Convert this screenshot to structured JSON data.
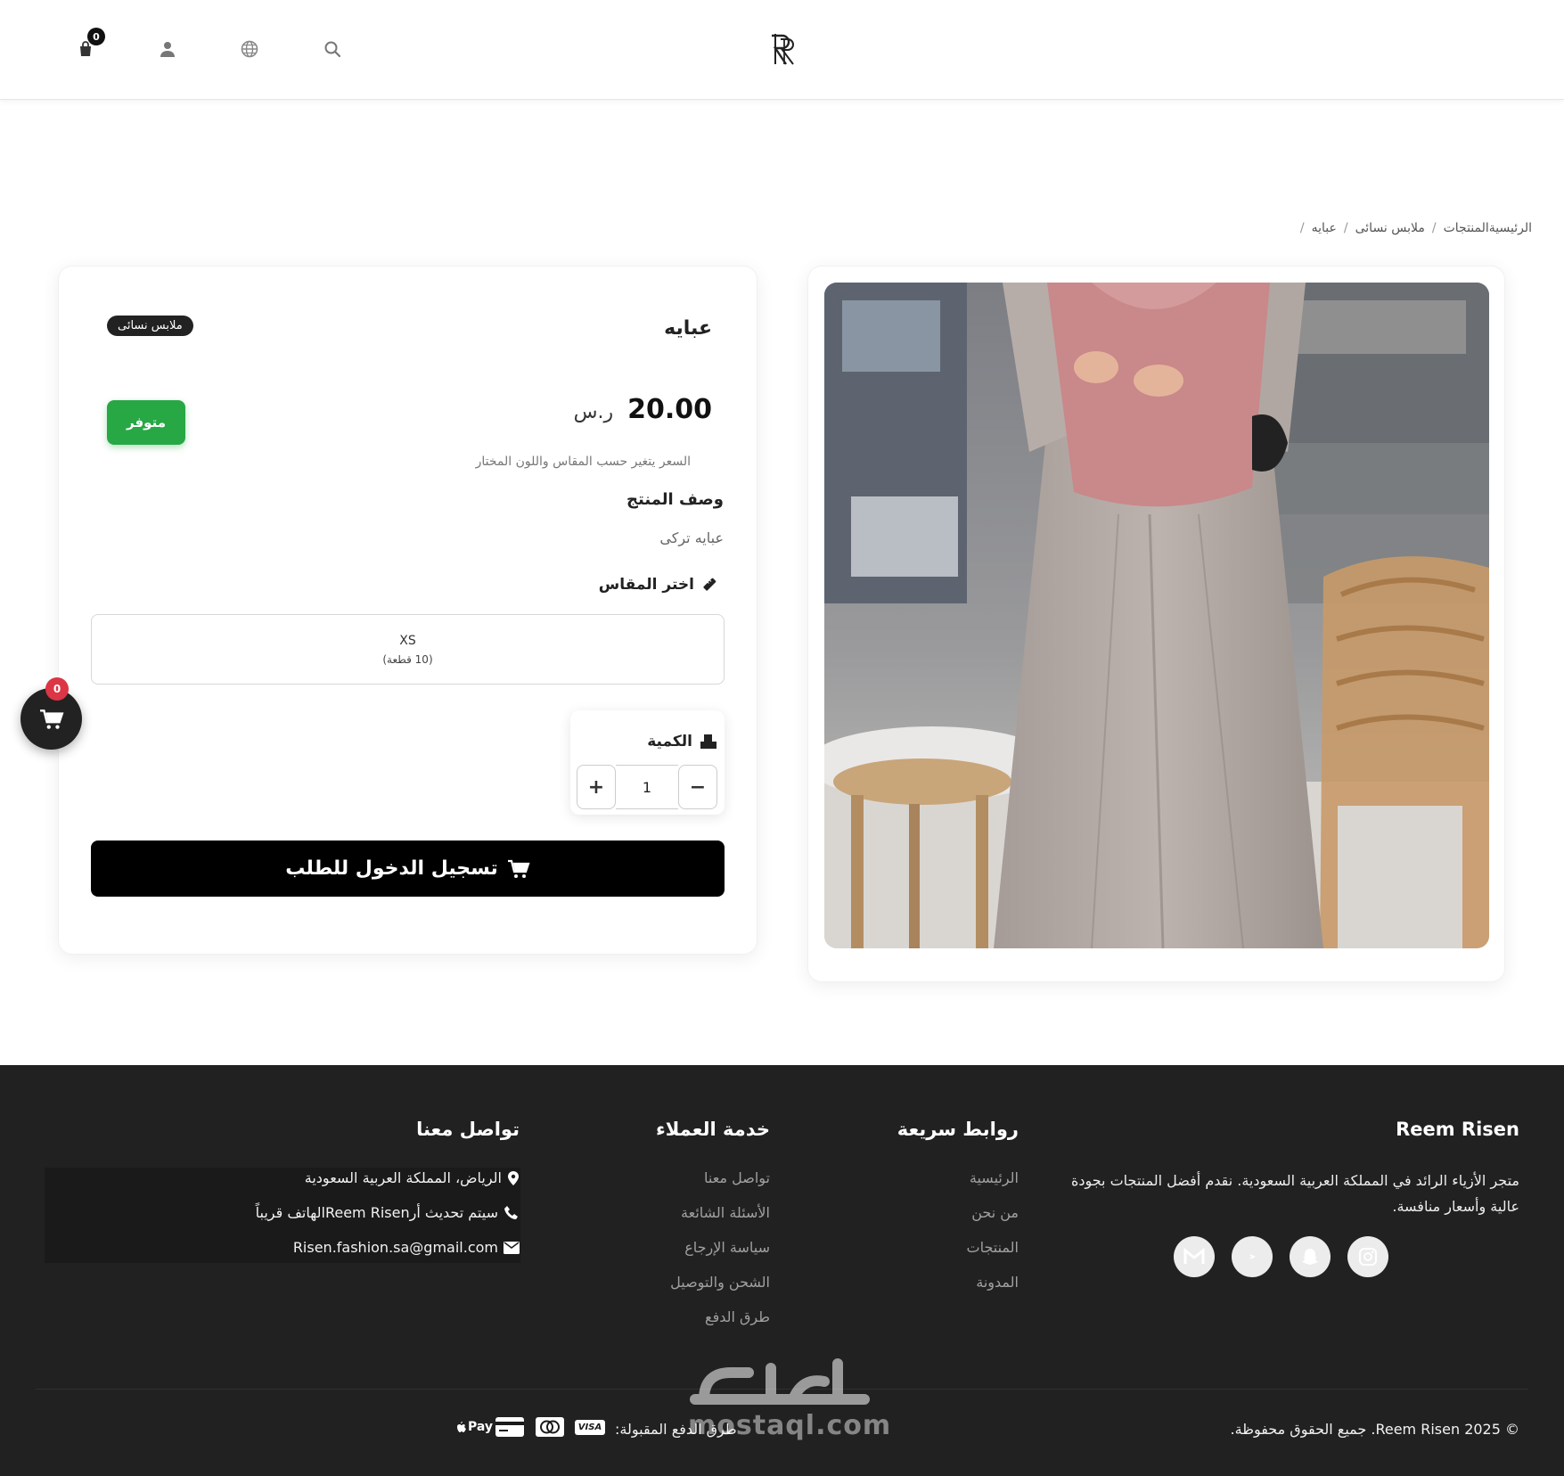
{
  "header": {
    "cart_count": "0",
    "icons": [
      "bag-icon",
      "user-icon",
      "globe-icon",
      "search-icon"
    ]
  },
  "breadcrumb": {
    "home_products": "الرئيسيةالمنتجات",
    "category": "ملابس نسائى",
    "current": "عبايه",
    "separator": "/"
  },
  "product": {
    "title": "عبايه",
    "category_pill": "ملابس نسائى",
    "price_value": "20.00",
    "currency": "ر.س",
    "stock_label": "متوفر",
    "price_note": "السعر يتغير حسب المقاس واللون المختار",
    "description_heading": "وصف المنتج",
    "description": "عبايه تركى",
    "size_heading": "اختر المقاس",
    "size_name": "XS",
    "size_stock": "(10 قطعة)",
    "quantity_label": "الكمية",
    "quantity_value": "1",
    "minus": "−",
    "plus": "+",
    "login_button": "تسجيل الدخول للطلب"
  },
  "floating_cart": {
    "count": "0"
  },
  "footer": {
    "brand_heading": "Reem Risen",
    "about_text": "متجر الأزياء الرائد في المملكة العربية السعودية. نقدم أفضل المنتجات بجودة عالية وأسعار منافسة.",
    "quick_links_heading": "روابط سريعة",
    "quick_links": [
      "الرئيسية",
      "من نحن",
      "المنتجات",
      "المدونة"
    ],
    "customer_service_heading": "خدمة العملاء",
    "customer_service": [
      "تواصل معنا",
      "الأسئلة الشائعة",
      "سياسة الإرجاع",
      "الشحن والتوصيل",
      "طرق الدفع"
    ],
    "contact_heading": "تواصل معنا",
    "contact_address": "الرياض، المملكة العربية السعودية",
    "contact_phone": "سيتم تحديث أرReem Risenالهاتف قريباً",
    "contact_email": "Risen.fashion.sa@gmail.com",
    "social_icons": [
      "instagram-icon",
      "snapchat-icon",
      "tiktok-icon",
      "gmail-icon"
    ],
    "copyright": "© 2025 Reem Risen. جميع الحقوق محفوظة.",
    "payment_label": "طرق الدفع المقبولة:",
    "payment_visa": "VISA",
    "payment_applepay": "Pay",
    "watermark_latin": "mostaql.com"
  },
  "colors": {
    "stock_green": "#28a745",
    "badge_red": "#dc3545",
    "footer_bg": "#212121"
  }
}
